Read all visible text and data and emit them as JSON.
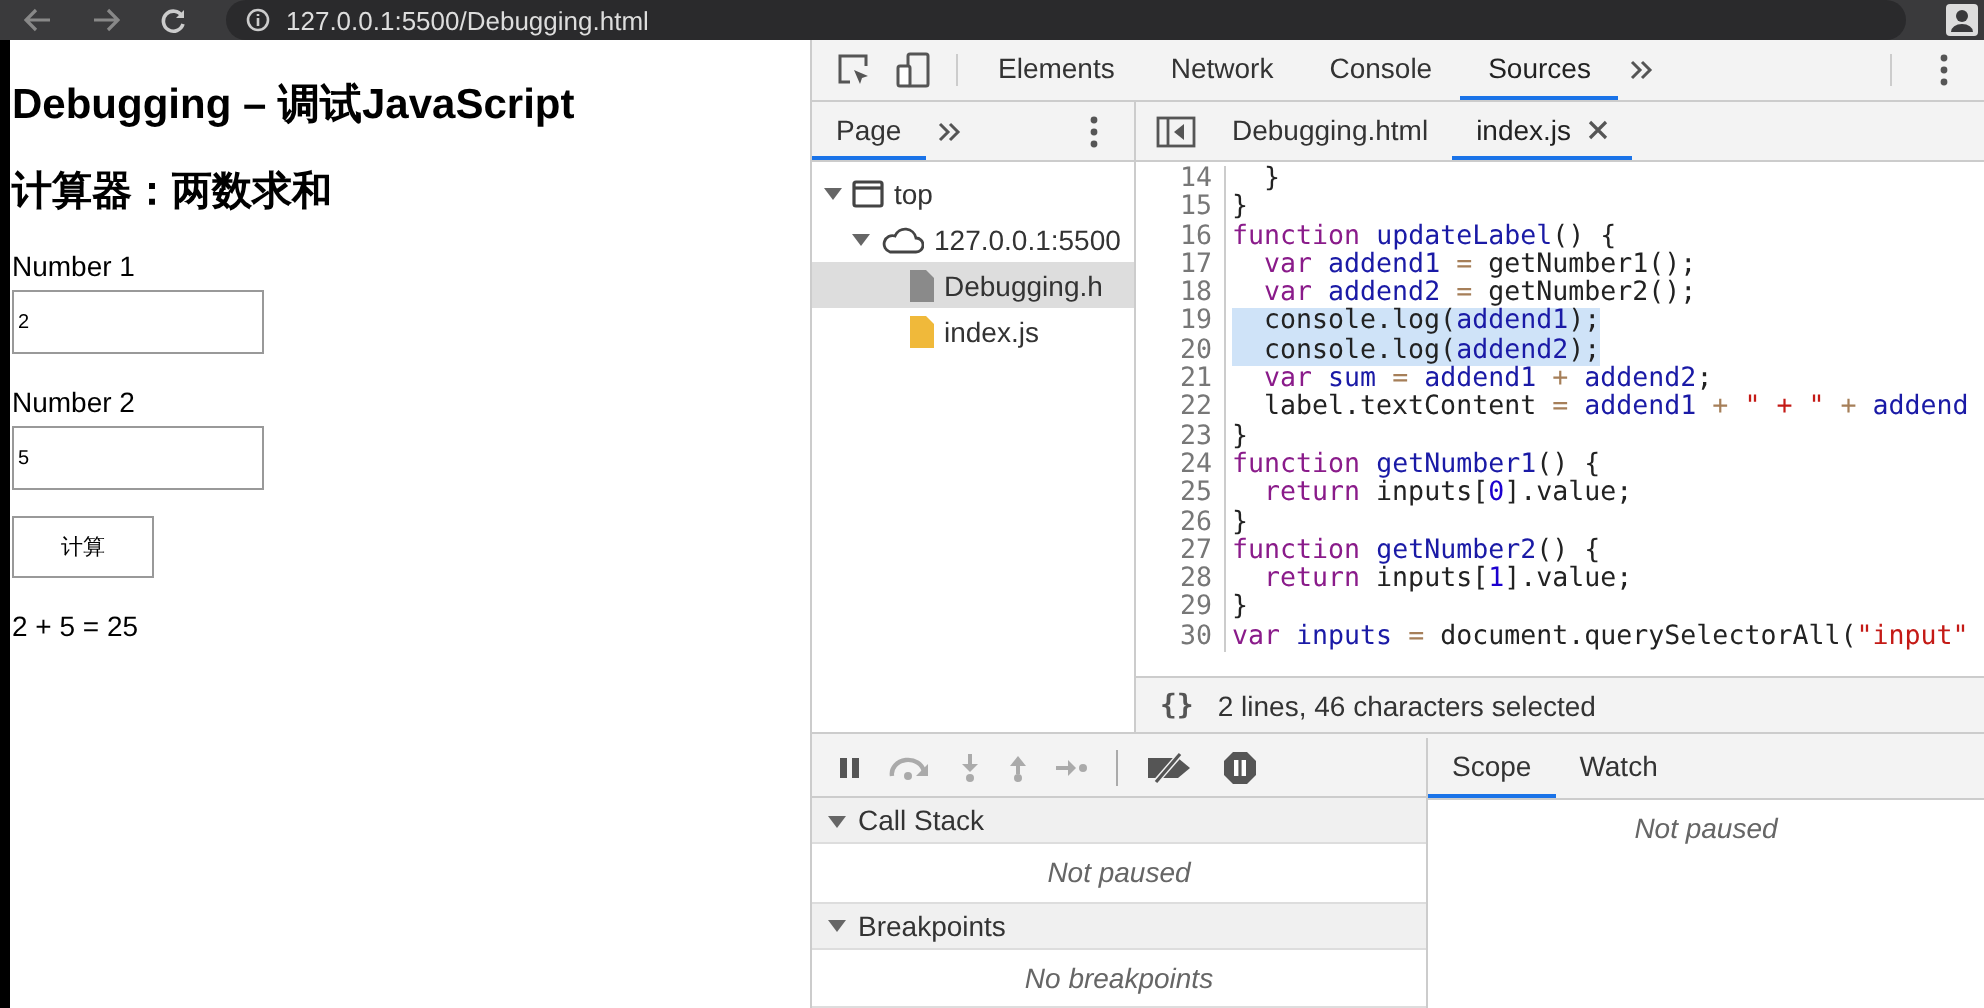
{
  "browser": {
    "url": "127.0.0.1:5500/Debugging.html"
  },
  "page": {
    "title": "Debugging – 调试JavaScript",
    "subtitle": "计算器：两数求和",
    "fields": [
      {
        "label": "Number 1",
        "value": "2"
      },
      {
        "label": "Number 2",
        "value": "5"
      }
    ],
    "button": "计算",
    "result": "2 + 5 = 25"
  },
  "devtools": {
    "tabs": [
      {
        "label": "Elements",
        "selected": false
      },
      {
        "label": "Network",
        "selected": false
      },
      {
        "label": "Console",
        "selected": false
      },
      {
        "label": "Sources",
        "selected": true
      }
    ],
    "navigator": {
      "tabs": [
        {
          "label": "Page",
          "selected": true
        }
      ],
      "tree": [
        {
          "label": "top",
          "kind": "frame",
          "expanded": true,
          "selected": false,
          "children": [
            {
              "label": "127.0.0.1:5500",
              "kind": "host",
              "expanded": true,
              "selected": false,
              "children": [
                {
                  "label": "Debugging.h",
                  "kind": "html",
                  "selected": true
                },
                {
                  "label": "index.js",
                  "kind": "js",
                  "selected": false
                }
              ]
            }
          ]
        }
      ]
    },
    "editor_tabs": [
      {
        "label": "Debugging.html",
        "selected": false
      },
      {
        "label": "index.js",
        "selected": true
      }
    ],
    "code": [
      {
        "n": "14",
        "indented": true,
        "selected": false,
        "tokens": [
          {
            "t": "}",
            "kind": "plain"
          }
        ]
      },
      {
        "n": "15",
        "indented": false,
        "selected": false,
        "tokens": [
          {
            "t": "}",
            "kind": "plain"
          }
        ]
      },
      {
        "n": "16",
        "indented": false,
        "selected": false,
        "tokens": [
          {
            "t": "function ",
            "kind": "keyword"
          },
          {
            "t": "updateLabel",
            "kind": "name"
          },
          {
            "t": "() {",
            "kind": "plain"
          }
        ]
      },
      {
        "n": "17",
        "indented": true,
        "selected": false,
        "tokens": [
          {
            "t": "var ",
            "kind": "keyword"
          },
          {
            "t": "addend1 ",
            "kind": "name"
          },
          {
            "t": "= ",
            "kind": "operator"
          },
          {
            "t": "getNumber1();",
            "kind": "plain"
          }
        ]
      },
      {
        "n": "18",
        "indented": true,
        "selected": false,
        "tokens": [
          {
            "t": "var ",
            "kind": "keyword"
          },
          {
            "t": "addend2 ",
            "kind": "name"
          },
          {
            "t": "= ",
            "kind": "operator"
          },
          {
            "t": "getNumber2();",
            "kind": "plain"
          }
        ]
      },
      {
        "n": "19",
        "indented": true,
        "selected": true,
        "tokens": [
          {
            "t": "console.log(",
            "kind": "plain"
          },
          {
            "t": "addend1",
            "kind": "name"
          },
          {
            "t": ");",
            "kind": "plain"
          }
        ]
      },
      {
        "n": "20",
        "indented": true,
        "selected": true,
        "tokens": [
          {
            "t": "console.log(",
            "kind": "plain"
          },
          {
            "t": "addend2",
            "kind": "name"
          },
          {
            "t": ");",
            "kind": "plain"
          }
        ]
      },
      {
        "n": "21",
        "indented": true,
        "selected": false,
        "tokens": [
          {
            "t": "var ",
            "kind": "keyword"
          },
          {
            "t": "sum ",
            "kind": "name"
          },
          {
            "t": "= ",
            "kind": "operator"
          },
          {
            "t": "addend1 ",
            "kind": "name"
          },
          {
            "t": "+ ",
            "kind": "operator"
          },
          {
            "t": "addend2",
            "kind": "name"
          },
          {
            "t": ";",
            "kind": "plain"
          }
        ]
      },
      {
        "n": "22",
        "indented": true,
        "selected": false,
        "tokens": [
          {
            "t": "label.textContent ",
            "kind": "plain"
          },
          {
            "t": "= ",
            "kind": "operator"
          },
          {
            "t": "addend1 ",
            "kind": "name"
          },
          {
            "t": "+ ",
            "kind": "operator"
          },
          {
            "t": "\" + \" ",
            "kind": "string"
          },
          {
            "t": "+ ",
            "kind": "operator"
          },
          {
            "t": "addend",
            "kind": "name"
          }
        ]
      },
      {
        "n": "23",
        "indented": false,
        "selected": false,
        "tokens": [
          {
            "t": "}",
            "kind": "plain"
          }
        ]
      },
      {
        "n": "24",
        "indented": false,
        "selected": false,
        "tokens": [
          {
            "t": "function ",
            "kind": "keyword"
          },
          {
            "t": "getNumber1",
            "kind": "name"
          },
          {
            "t": "() {",
            "kind": "plain"
          }
        ]
      },
      {
        "n": "25",
        "indented": true,
        "selected": false,
        "tokens": [
          {
            "t": "return ",
            "kind": "keyword"
          },
          {
            "t": "inputs[",
            "kind": "plain"
          },
          {
            "t": "0",
            "kind": "number"
          },
          {
            "t": "].value;",
            "kind": "plain"
          }
        ]
      },
      {
        "n": "26",
        "indented": false,
        "selected": false,
        "tokens": [
          {
            "t": "}",
            "kind": "plain"
          }
        ]
      },
      {
        "n": "27",
        "indented": false,
        "selected": false,
        "tokens": [
          {
            "t": "function ",
            "kind": "keyword"
          },
          {
            "t": "getNumber2",
            "kind": "name"
          },
          {
            "t": "() {",
            "kind": "plain"
          }
        ]
      },
      {
        "n": "28",
        "indented": true,
        "selected": false,
        "tokens": [
          {
            "t": "return ",
            "kind": "keyword"
          },
          {
            "t": "inputs[",
            "kind": "plain"
          },
          {
            "t": "1",
            "kind": "number"
          },
          {
            "t": "].value;",
            "kind": "plain"
          }
        ]
      },
      {
        "n": "29",
        "indented": false,
        "selected": false,
        "tokens": [
          {
            "t": "}",
            "kind": "plain"
          }
        ]
      },
      {
        "n": "30",
        "indented": false,
        "selected": false,
        "tokens": [
          {
            "t": "var ",
            "kind": "keyword"
          },
          {
            "t": "inputs ",
            "kind": "name"
          },
          {
            "t": "= ",
            "kind": "operator"
          },
          {
            "t": "document.querySelectorAll(",
            "kind": "plain"
          },
          {
            "t": "\"input\"",
            "kind": "string"
          }
        ]
      }
    ],
    "status": {
      "icon_text": "{}",
      "text": "2 lines, 46 characters selected"
    },
    "sections": [
      {
        "title": "Call Stack",
        "expanded": true,
        "message": "Not paused"
      },
      {
        "title": "Breakpoints",
        "expanded": true,
        "message": "No breakpoints"
      }
    ],
    "side_tabs": [
      {
        "label": "Scope",
        "selected": true
      },
      {
        "label": "Watch",
        "selected": false
      }
    ],
    "scope_message": "Not paused"
  }
}
